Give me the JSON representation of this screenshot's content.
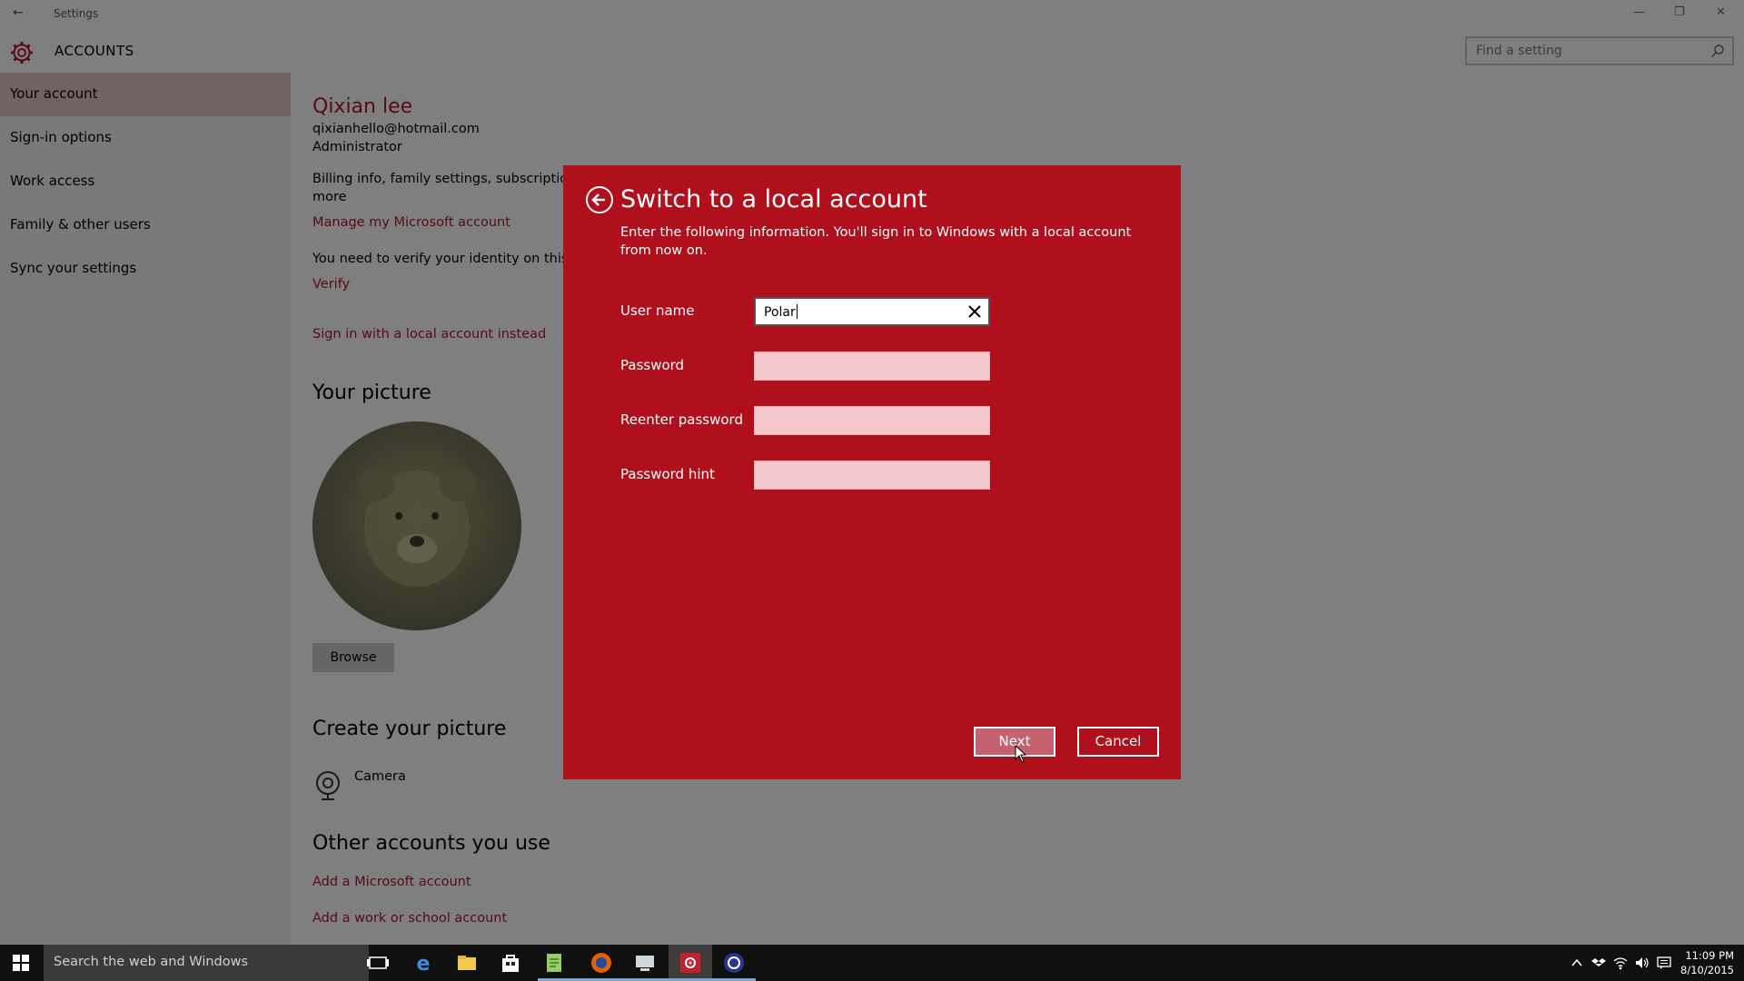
{
  "window": {
    "title": "Settings",
    "back_glyph": "←",
    "minimize_glyph": "—",
    "restore_glyph": "❐",
    "close_glyph": "✕"
  },
  "header": {
    "section_title": "ACCOUNTS",
    "search_placeholder": "Find a setting",
    "icon": "gear-icon"
  },
  "sidebar": {
    "items": [
      {
        "label": "Your account",
        "active": true
      },
      {
        "label": "Sign-in options"
      },
      {
        "label": "Work access"
      },
      {
        "label": "Family & other users"
      },
      {
        "label": "Sync your settings"
      }
    ]
  },
  "account": {
    "name": "Qixian lee",
    "email": "qixianhello@hotmail.com",
    "role": "Administrator",
    "billing_line1": "Billing info, family settings, subscriptions,",
    "billing_line2": "more",
    "manage_link": "Manage my Microsoft account",
    "verify_text": "You need to verify your identity on this PC",
    "verify_link": "Verify",
    "local_link": "Sign in with a local account instead"
  },
  "picture": {
    "heading": "Your picture",
    "browse_label": "Browse",
    "create_heading": "Create your picture",
    "camera_label": "Camera"
  },
  "other_accounts": {
    "heading": "Other accounts you use",
    "add_microsoft": "Add a Microsoft account",
    "add_work": "Add a work or school account"
  },
  "dialog": {
    "title": "Switch to a local account",
    "description": "Enter the following information. You'll sign in to Windows with a local account from now on.",
    "fields": {
      "username_label": "User name",
      "username_value": "Polar",
      "password_label": "Password",
      "reenter_label": "Reenter password",
      "hint_label": "Password hint"
    },
    "next_label": "Next",
    "cancel_label": "Cancel",
    "accent_color": "#b0101c"
  },
  "taskbar": {
    "search_placeholder": "Search the web and Windows",
    "apps": [
      "task-view-icon",
      "edge-icon",
      "file-explorer-icon",
      "store-icon",
      "notepad-icon",
      "firefox-icon",
      "remote-desktop-icon",
      "settings-icon",
      "vpn-icon"
    ],
    "time": "11:09 PM",
    "date": "8/10/2015"
  }
}
